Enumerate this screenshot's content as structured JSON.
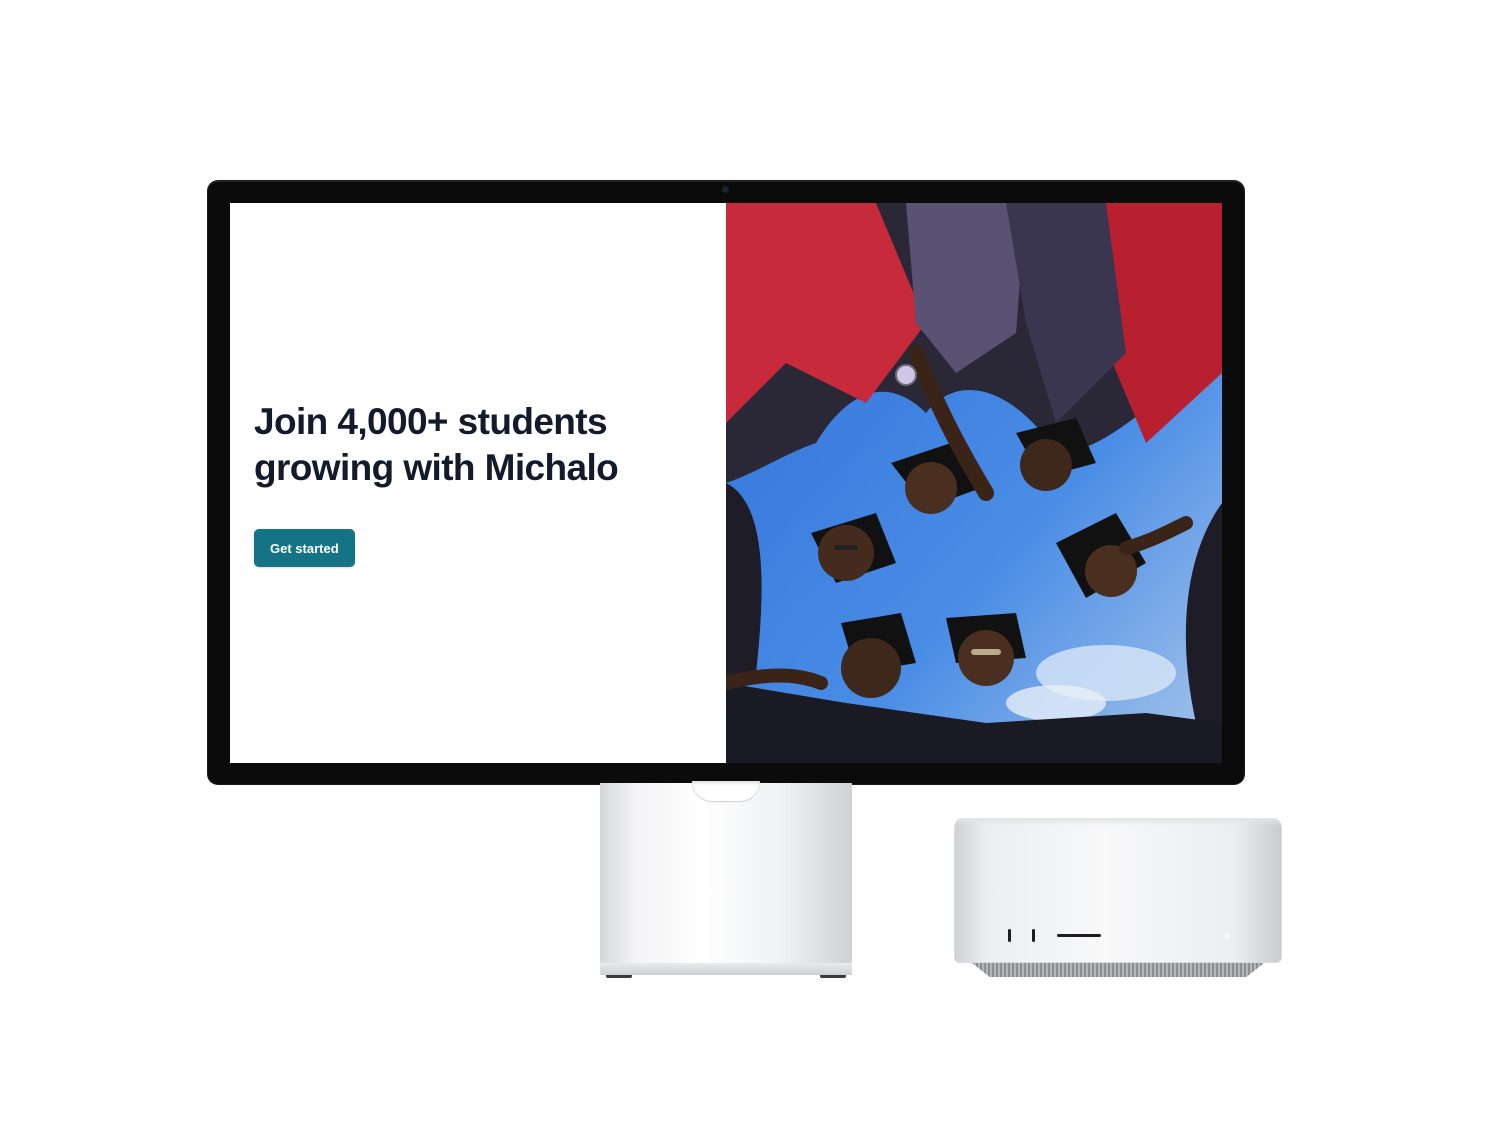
{
  "hero": {
    "title": "Join 4,000+ students growing with Michalo",
    "cta_label": "Get started"
  },
  "colors": {
    "cta_background": "#147384",
    "title_text": "#131a2b",
    "sky": "#3f7fe0",
    "monitor_bezel": "#0b0b0c"
  },
  "hero_image": {
    "subject": "graduates-in-caps-circle-from-below"
  }
}
